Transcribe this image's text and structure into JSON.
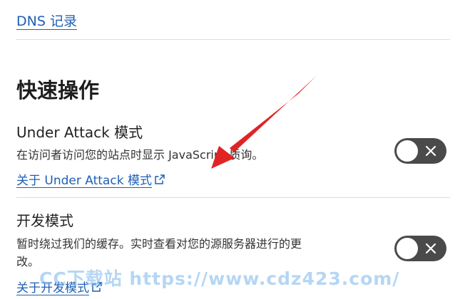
{
  "header": {
    "dns_link": "DNS 记录"
  },
  "quick_actions": {
    "title": "快速操作",
    "settings": [
      {
        "title": "Under Attack 模式",
        "description": "在访问者访问您的站点时显示 JavaScript 质询。",
        "link": "关于 Under Attack 模式",
        "toggle_on": false
      },
      {
        "title": "开发模式",
        "description_line1": "暂时绕过我们的缓存。实时查看对您的源服务器进行的更",
        "description_line2": "改。",
        "link": "关于开发模式",
        "toggle_on": false
      }
    ]
  },
  "annotation": {
    "arrow_color": "#e02424"
  },
  "watermark": "CC下载站 https://www.cdz423.com/",
  "colors": {
    "link": "#1e5fb4",
    "toggle_off": "#4a4a4a"
  }
}
